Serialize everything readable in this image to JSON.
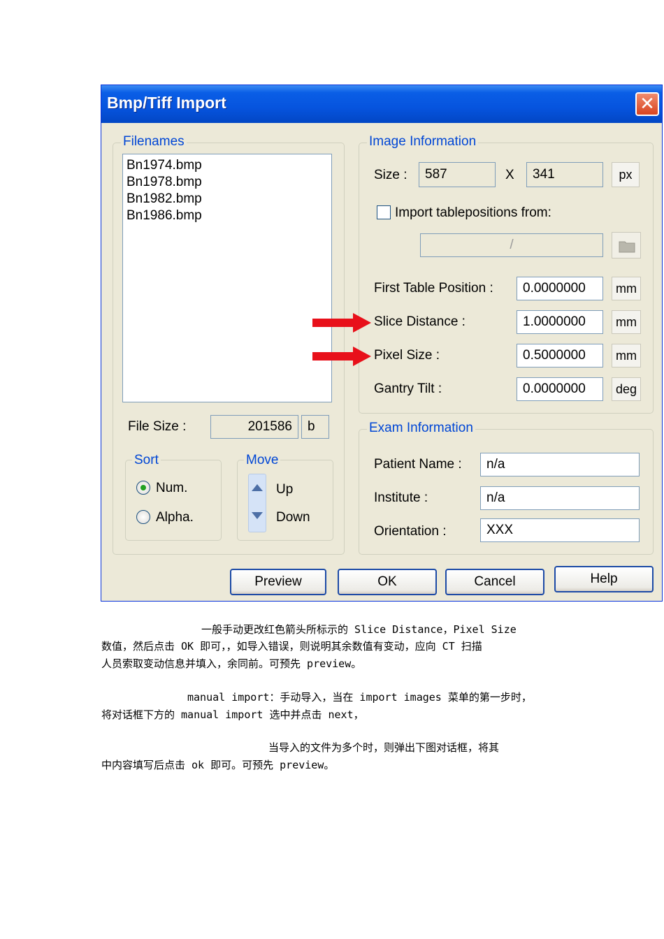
{
  "window": {
    "title": "Bmp/Tiff Import",
    "close_glyph": "✕"
  },
  "filenames": {
    "legend": "Filenames",
    "items": [
      "Bn1974.bmp",
      "Bn1978.bmp",
      "Bn1982.bmp",
      "Bn1986.bmp"
    ],
    "file_size_label": "File Size :",
    "file_size_value": "201586",
    "file_size_unit": "b"
  },
  "sort": {
    "legend": "Sort",
    "options": [
      "Num.",
      "Alpha."
    ],
    "selected": "Num."
  },
  "move": {
    "legend": "Move",
    "up": "Up",
    "down": "Down"
  },
  "image_info": {
    "legend": "Image Information",
    "size_label": "Size :",
    "width": "587",
    "x_sep": "X",
    "height": "341",
    "size_unit": "px",
    "import_table_label": "Import tablepositions from:",
    "import_path": "/",
    "rows": [
      {
        "label": "First Table Position :",
        "value": "0.0000000",
        "unit": "mm"
      },
      {
        "label": "Slice Distance :",
        "value": "1.0000000",
        "unit": "mm"
      },
      {
        "label": "Pixel Size :",
        "value": "0.5000000",
        "unit": "mm"
      },
      {
        "label": "Gantry Tilt :",
        "value": "0.0000000",
        "unit": "deg"
      }
    ]
  },
  "exam_info": {
    "legend": "Exam Information",
    "rows": [
      {
        "label": "Patient Name :",
        "value": "n/a"
      },
      {
        "label": "Institute :",
        "value": "n/a"
      },
      {
        "label": "Orientation :",
        "value": "XXX"
      }
    ]
  },
  "buttons": {
    "preview": "Preview",
    "ok": "OK",
    "cancel": "Cancel",
    "help": "Help"
  },
  "annotation_color": "#e8101a",
  "paragraphs": [
    {
      "line1": "一般手动更改红色箭头所标示的 Slice Distance，Pixel Size",
      "line2": "数值，然后点击 OK 即可，，如导入错误，则说明其余数值有变动，应向 CT 扫描",
      "line3": "人员索取变动信息并填入，余同前。可预先 preview。"
    },
    {
      "line1": "manual import：手动导入，当在 import images 菜单的第一步时，",
      "line2": "将对话框下方的 manual  import 选中并点击 next，"
    },
    {
      "line1": "当导入的文件为多个时，则弹出下图对话框，将其",
      "line2": "中内容填写后点击 ok 即可。可预先 preview。"
    }
  ]
}
